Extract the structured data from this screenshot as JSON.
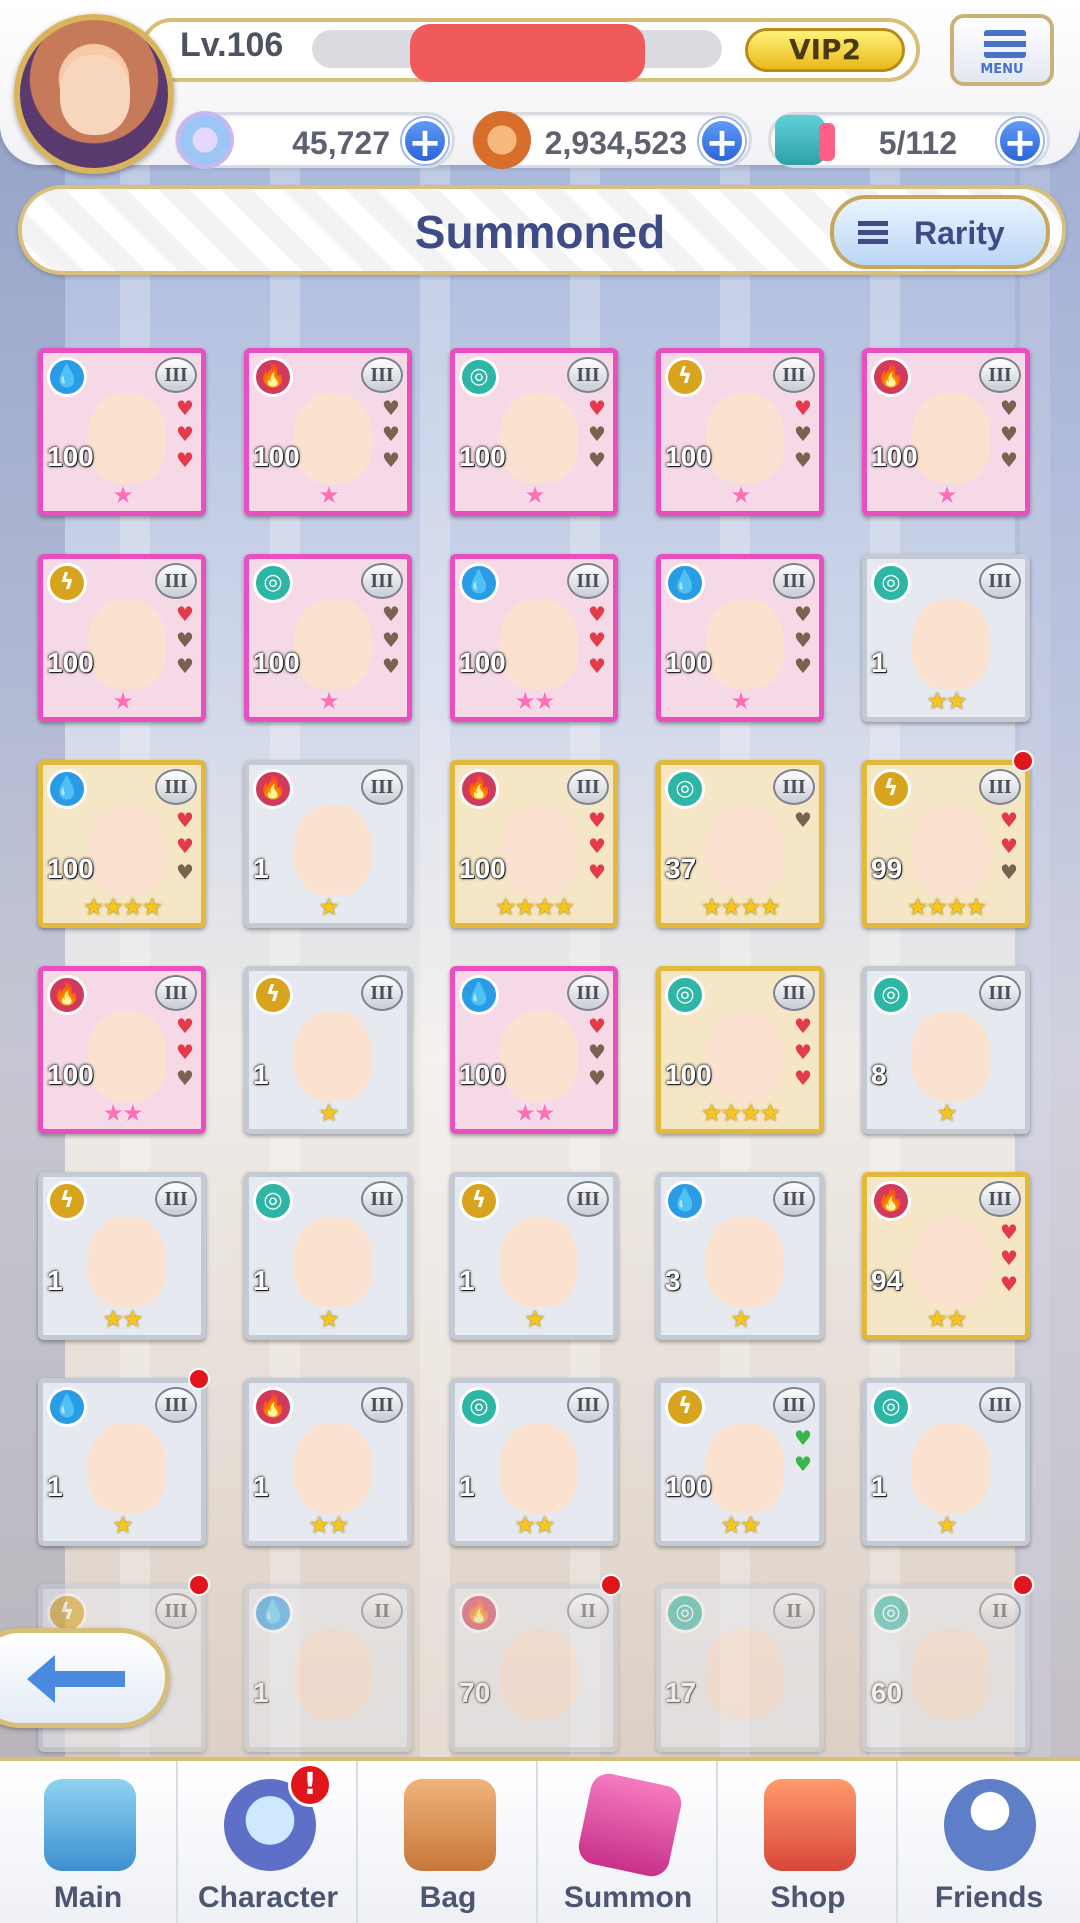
{
  "header": {
    "level": "Lv.106",
    "vip": "VIP2",
    "menu_label": "MENU",
    "resources": [
      {
        "icon": "star-gem-icon",
        "value": "45,727"
      },
      {
        "icon": "coin-icon",
        "value": "2,934,523"
      },
      {
        "icon": "ap-icon",
        "value": "5/112"
      }
    ]
  },
  "title": "Summoned",
  "sort_button": "Rarity",
  "cards": [
    {
      "element": "water",
      "rarity": 5,
      "level": "100",
      "stars": 1,
      "star_color": "pink",
      "hearts": 3,
      "hearts_on": 3
    },
    {
      "element": "fire",
      "rarity": 5,
      "level": "100",
      "stars": 1,
      "star_color": "pink",
      "hearts": 3,
      "hearts_on": 0
    },
    {
      "element": "wind",
      "rarity": 5,
      "level": "100",
      "stars": 1,
      "star_color": "pink",
      "hearts": 3,
      "hearts_on": 1
    },
    {
      "element": "thunder",
      "rarity": 5,
      "level": "100",
      "stars": 1,
      "star_color": "pink",
      "hearts": 3,
      "hearts_on": 1
    },
    {
      "element": "fire",
      "rarity": 5,
      "level": "100",
      "stars": 1,
      "star_color": "pink",
      "hearts": 3,
      "hearts_on": 0
    },
    {
      "element": "thunder",
      "rarity": 5,
      "level": "100",
      "stars": 1,
      "star_color": "pink",
      "hearts": 3,
      "hearts_on": 1
    },
    {
      "element": "wind",
      "rarity": 5,
      "level": "100",
      "stars": 1,
      "star_color": "pink",
      "hearts": 3,
      "hearts_on": 0
    },
    {
      "element": "water",
      "rarity": 5,
      "level": "100",
      "stars": 2,
      "star_color": "pink",
      "hearts": 3,
      "hearts_on": 3
    },
    {
      "element": "water",
      "rarity": 5,
      "level": "100",
      "stars": 1,
      "star_color": "pink",
      "hearts": 3,
      "hearts_on": 0
    },
    {
      "element": "wind",
      "rarity": 3,
      "level": "1",
      "stars": 2,
      "star_color": "gold",
      "hearts": 0,
      "hearts_on": 0
    },
    {
      "element": "water",
      "rarity": 4,
      "level": "100",
      "stars": 4,
      "star_color": "gold",
      "hearts": 3,
      "hearts_on": 2
    },
    {
      "element": "fire",
      "rarity": 3,
      "level": "1",
      "stars": 1,
      "star_color": "gold",
      "hearts": 0,
      "hearts_on": 0
    },
    {
      "element": "fire",
      "rarity": 4,
      "level": "100",
      "stars": 4,
      "star_color": "gold",
      "hearts": 3,
      "hearts_on": 3
    },
    {
      "element": "wind",
      "rarity": 4,
      "level": "37",
      "stars": 4,
      "star_color": "gold",
      "hearts": 1,
      "hearts_on": 0
    },
    {
      "element": "thunder",
      "rarity": 4,
      "level": "99",
      "stars": 4,
      "star_color": "gold",
      "hearts": 3,
      "hearts_on": 2,
      "notif": true
    },
    {
      "element": "fire",
      "rarity": 5,
      "level": "100",
      "stars": 2,
      "star_color": "pink",
      "hearts": 3,
      "hearts_on": 2
    },
    {
      "element": "thunder",
      "rarity": 3,
      "level": "1",
      "stars": 1,
      "star_color": "gold",
      "hearts": 0,
      "hearts_on": 0
    },
    {
      "element": "water",
      "rarity": 5,
      "level": "100",
      "stars": 2,
      "star_color": "pink",
      "hearts": 3,
      "hearts_on": 1
    },
    {
      "element": "wind",
      "rarity": 4,
      "level": "100",
      "stars": 4,
      "star_color": "gold",
      "hearts": 3,
      "hearts_on": 3
    },
    {
      "element": "wind",
      "rarity": 3,
      "level": "8",
      "stars": 1,
      "star_color": "gold",
      "hearts": 0,
      "hearts_on": 0
    },
    {
      "element": "thunder",
      "rarity": 3,
      "level": "1",
      "stars": 2,
      "star_color": "gold",
      "hearts": 0,
      "hearts_on": 0
    },
    {
      "element": "wind",
      "rarity": 3,
      "level": "1",
      "stars": 1,
      "star_color": "gold",
      "hearts": 0,
      "hearts_on": 0
    },
    {
      "element": "thunder",
      "rarity": 3,
      "level": "1",
      "stars": 1,
      "star_color": "gold",
      "hearts": 0,
      "hearts_on": 0
    },
    {
      "element": "water",
      "rarity": 3,
      "level": "3",
      "stars": 1,
      "star_color": "gold",
      "hearts": 0,
      "hearts_on": 0
    },
    {
      "element": "fire",
      "rarity": 4,
      "level": "94",
      "stars": 2,
      "star_color": "gold",
      "hearts": 3,
      "hearts_on": 3
    },
    {
      "element": "water",
      "rarity": 3,
      "level": "1",
      "stars": 1,
      "star_color": "gold",
      "hearts": 0,
      "hearts_on": 0,
      "notif": true
    },
    {
      "element": "fire",
      "rarity": 3,
      "level": "1",
      "stars": 2,
      "star_color": "gold",
      "hearts": 0,
      "hearts_on": 0
    },
    {
      "element": "wind",
      "rarity": 3,
      "level": "1",
      "stars": 2,
      "star_color": "gold",
      "hearts": 0,
      "hearts_on": 0
    },
    {
      "element": "thunder",
      "rarity": 3,
      "level": "100",
      "stars": 2,
      "star_color": "gold",
      "hearts": 2,
      "hearts_on": 2,
      "green": true
    },
    {
      "element": "wind",
      "rarity": 3,
      "level": "1",
      "stars": 1,
      "star_color": "gold",
      "hearts": 0,
      "hearts_on": 0
    },
    {
      "element": "thunder",
      "rarity": 3,
      "level": "",
      "stars": 0,
      "star_color": "gold",
      "hearts": 0,
      "hearts_on": 0,
      "notif": true
    },
    {
      "element": "water",
      "rarity": 3,
      "level": "1",
      "stars": 0,
      "star_color": "gold",
      "hearts": 0,
      "hearts_on": 0
    },
    {
      "element": "fire",
      "rarity": 3,
      "level": "70",
      "stars": 0,
      "star_color": "gold",
      "hearts": 0,
      "hearts_on": 0,
      "notif": true
    },
    {
      "element": "wind",
      "rarity": 3,
      "level": "17",
      "stars": 0,
      "star_color": "gold",
      "hearts": 0,
      "hearts_on": 0
    },
    {
      "element": "wind",
      "rarity": 3,
      "level": "60",
      "stars": 0,
      "star_color": "gold",
      "hearts": 0,
      "hearts_on": 0,
      "notif": true
    }
  ],
  "tiers": [
    "III",
    "III",
    "III",
    "III",
    "III",
    "III",
    "III",
    "III",
    "III",
    "III",
    "III",
    "III",
    "III",
    "III",
    "III",
    "III",
    "III",
    "III",
    "III",
    "III",
    "III",
    "III",
    "III",
    "III",
    "III",
    "III",
    "III",
    "III",
    "III",
    "III",
    "III",
    "II",
    "II",
    "II",
    "II"
  ],
  "nav": [
    {
      "label": "Main",
      "icon": "city-icon"
    },
    {
      "label": "Character",
      "icon": "character-icon",
      "badge": "!"
    },
    {
      "label": "Bag",
      "icon": "bag-icon"
    },
    {
      "label": "Summon",
      "icon": "phone-icon"
    },
    {
      "label": "Shop",
      "icon": "cart-icon"
    },
    {
      "label": "Friends",
      "icon": "friends-icon"
    }
  ],
  "colors": {
    "accent": "#3f4b84",
    "gold_frame": "#d8bf78",
    "plus_button": "#2e63d8"
  }
}
